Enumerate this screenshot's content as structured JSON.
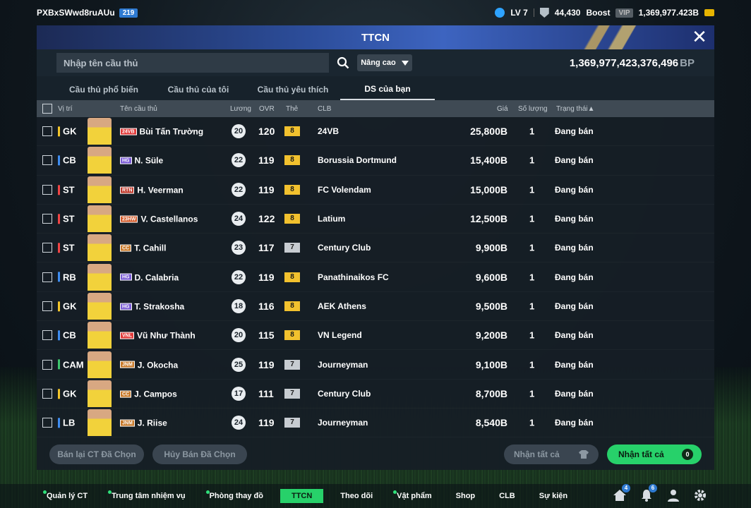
{
  "topbar": {
    "username": "PXBxSWwd8ruAUu",
    "user_tag": "219",
    "level": "LV 7",
    "points": "44,430",
    "boost_label": "Boost",
    "vip_label": "VIP",
    "currency": "1,369,977.423B"
  },
  "window": {
    "title": "TTCN",
    "close_glyph": "✕"
  },
  "search": {
    "placeholder": "Nhập tên cầu thủ",
    "advanced_label": "Nâng cao",
    "bp_value": "1,369,977,423,376,496",
    "bp_unit": "BP"
  },
  "tabs": [
    {
      "label": "Cầu thủ phổ biến",
      "active": false
    },
    {
      "label": "Cầu thủ của tôi",
      "active": false
    },
    {
      "label": "Cầu thủ yêu thích",
      "active": false
    },
    {
      "label": "DS của bạn",
      "active": true
    }
  ],
  "columns": {
    "position": "Vị trí",
    "name": "Tên cầu thủ",
    "wage": "Lương",
    "ovr": "OVR",
    "card": "Thẻ",
    "club": "CLB",
    "price": "Giá",
    "qty": "Số lượng",
    "status": "Trạng thái▲"
  },
  "rows": [
    {
      "pos": "GK",
      "pos_color": "#f3c52b",
      "season": "24VB",
      "season_color": "#e23b3b",
      "name": "Bùi Tấn Trường",
      "wage": "20",
      "ovr": "120",
      "grade": "8",
      "grade_color": "#f2c12e",
      "club": "24VB",
      "price": "25,800B",
      "qty": "1",
      "status": "Đang bán"
    },
    {
      "pos": "CB",
      "pos_color": "#3f8df0",
      "season": "HG",
      "season_color": "#7b5cd6",
      "name": "N. Süle",
      "wage": "22",
      "ovr": "119",
      "grade": "8",
      "grade_color": "#f2c12e",
      "club": "Borussia Dortmund",
      "price": "15,400B",
      "qty": "1",
      "status": "Đang bán"
    },
    {
      "pos": "ST",
      "pos_color": "#f04545",
      "season": "RTN",
      "season_color": "#c0392b",
      "name": "H. Veerman",
      "wage": "22",
      "ovr": "119",
      "grade": "8",
      "grade_color": "#f2c12e",
      "club": "FC Volendam",
      "price": "15,000B",
      "qty": "1",
      "status": "Đang bán"
    },
    {
      "pos": "ST",
      "pos_color": "#f04545",
      "season": "23HW",
      "season_color": "#d35b2a",
      "name": "V. Castellanos",
      "wage": "24",
      "ovr": "122",
      "grade": "8",
      "grade_color": "#f2c12e",
      "club": "Latium",
      "price": "12,500B",
      "qty": "1",
      "status": "Đang bán"
    },
    {
      "pos": "ST",
      "pos_color": "#f04545",
      "season": "CC",
      "season_color": "#c97a2a",
      "name": "T. Cahill",
      "wage": "23",
      "ovr": "117",
      "grade": "7",
      "grade_color": "#c7ccd1",
      "club": "Century Club",
      "price": "9,900B",
      "qty": "1",
      "status": "Đang bán"
    },
    {
      "pos": "RB",
      "pos_color": "#3f8df0",
      "season": "HG",
      "season_color": "#7b5cd6",
      "name": "D. Calabria",
      "wage": "22",
      "ovr": "119",
      "grade": "8",
      "grade_color": "#f2c12e",
      "club": "Panathinaikos FC",
      "price": "9,600B",
      "qty": "1",
      "status": "Đang bán"
    },
    {
      "pos": "GK",
      "pos_color": "#f3c52b",
      "season": "HG",
      "season_color": "#7b5cd6",
      "name": "T. Strakosha",
      "wage": "18",
      "ovr": "116",
      "grade": "8",
      "grade_color": "#f2c12e",
      "club": "AEK Athens",
      "price": "9,500B",
      "qty": "1",
      "status": "Đang bán"
    },
    {
      "pos": "CB",
      "pos_color": "#3f8df0",
      "season": "VNL",
      "season_color": "#e23b3b",
      "name": "Vũ Như Thành",
      "wage": "20",
      "ovr": "115",
      "grade": "8",
      "grade_color": "#f2c12e",
      "club": "VN Legend",
      "price": "9,200B",
      "qty": "1",
      "status": "Đang bán"
    },
    {
      "pos": "CAM",
      "pos_color": "#3ec46d",
      "season": "JNM",
      "season_color": "#c97a2a",
      "name": "J. Okocha",
      "wage": "25",
      "ovr": "119",
      "grade": "7",
      "grade_color": "#c7ccd1",
      "club": "Journeyman",
      "price": "9,100B",
      "qty": "1",
      "status": "Đang bán"
    },
    {
      "pos": "GK",
      "pos_color": "#f3c52b",
      "season": "CC",
      "season_color": "#c97a2a",
      "name": "J. Campos",
      "wage": "17",
      "ovr": "111",
      "grade": "7",
      "grade_color": "#c7ccd1",
      "club": "Century Club",
      "price": "8,700B",
      "qty": "1",
      "status": "Đang bán"
    },
    {
      "pos": "LB",
      "pos_color": "#3f8df0",
      "season": "JNM",
      "season_color": "#c97a2a",
      "name": "J. Riise",
      "wage": "24",
      "ovr": "119",
      "grade": "7",
      "grade_color": "#c7ccd1",
      "club": "Journeyman",
      "price": "8,540B",
      "qty": "1",
      "status": "Đang bán"
    }
  ],
  "actions": {
    "resell_label": "Bán lại CT Đã Chọn",
    "cancel_label": "Hủy Bán Đã Chọn",
    "collect_disabled_label": "Nhận tất cả",
    "collect_label": "Nhận tất cả",
    "collect_count": "0"
  },
  "bottom_nav": [
    {
      "label": "Quản lý CT",
      "dot": true,
      "active": false
    },
    {
      "label": "Trung tâm nhiệm vụ",
      "dot": true,
      "active": false
    },
    {
      "label": "Phòng thay đồ",
      "dot": true,
      "active": false
    },
    {
      "label": "TTCN",
      "dot": false,
      "active": true
    },
    {
      "label": "Theo dõi",
      "dot": false,
      "active": false
    },
    {
      "label": "Vật phẩm",
      "dot": true,
      "active": false
    },
    {
      "label": "Shop",
      "dot": false,
      "active": false
    },
    {
      "label": "CLB",
      "dot": false,
      "active": false
    },
    {
      "label": "Sự kiện",
      "dot": false,
      "active": false
    }
  ],
  "nav_icons": [
    {
      "icon": "home-icon",
      "badge": "4"
    },
    {
      "icon": "bell-icon",
      "badge": "6"
    },
    {
      "icon": "person-icon",
      "badge": ""
    },
    {
      "icon": "gear-icon",
      "badge": ""
    }
  ]
}
